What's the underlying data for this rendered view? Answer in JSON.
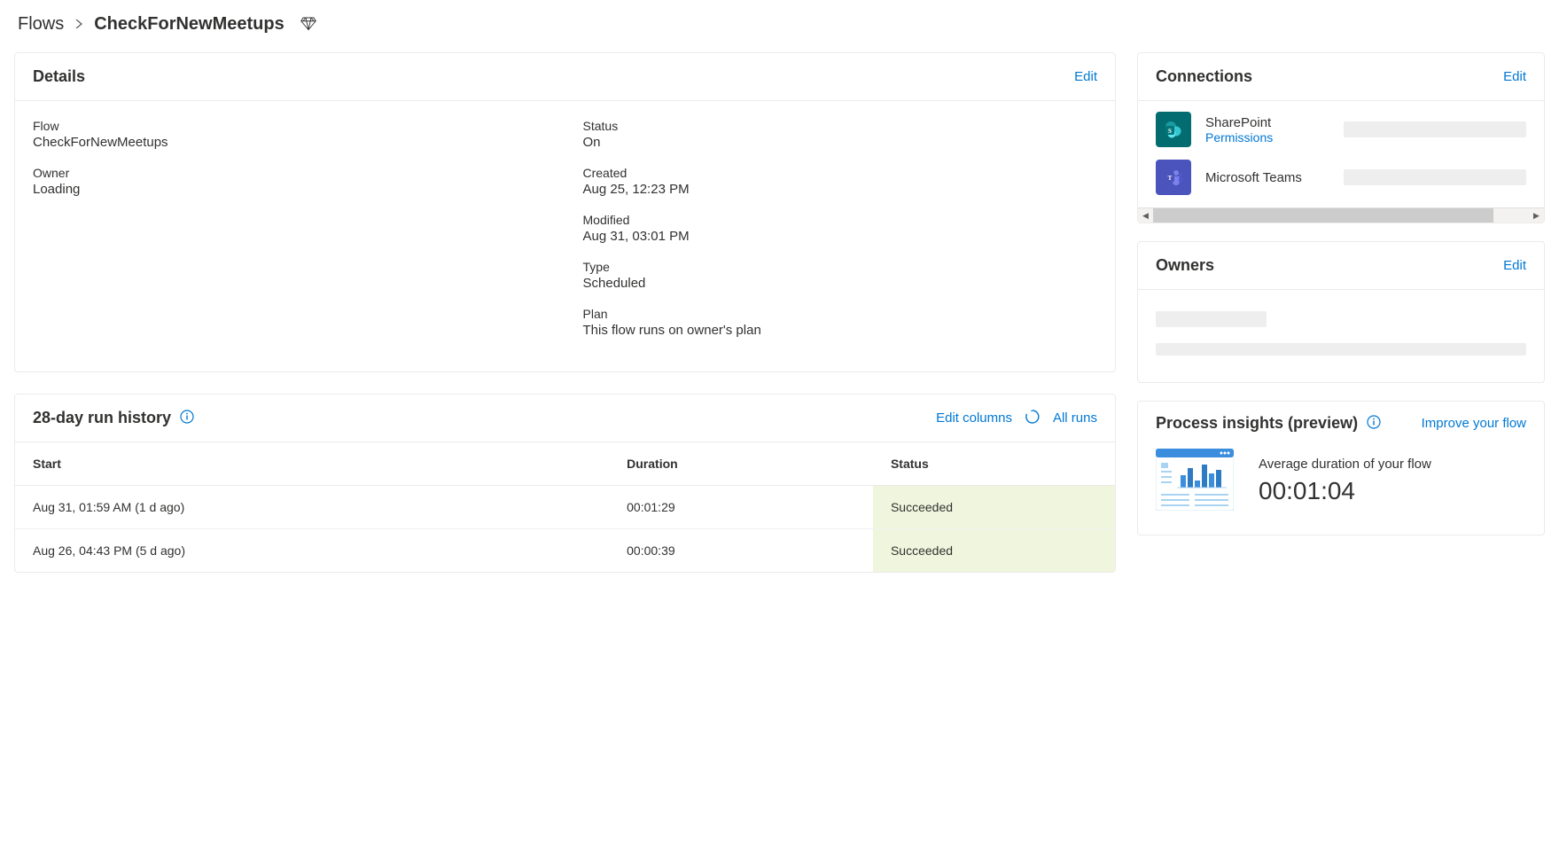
{
  "breadcrumb": {
    "root": "Flows",
    "current": "CheckForNewMeetups"
  },
  "details": {
    "title": "Details",
    "editLabel": "Edit",
    "fields": {
      "flowLabel": "Flow",
      "flowValue": "CheckForNewMeetups",
      "ownerLabel": "Owner",
      "ownerValue": "Loading",
      "statusLabel": "Status",
      "statusValue": "On",
      "createdLabel": "Created",
      "createdValue": "Aug 25, 12:23 PM",
      "modifiedLabel": "Modified",
      "modifiedValue": "Aug 31, 03:01 PM",
      "typeLabel": "Type",
      "typeValue": "Scheduled",
      "planLabel": "Plan",
      "planValue": "This flow runs on owner's plan"
    }
  },
  "history": {
    "title": "28-day run history",
    "editColumnsLabel": "Edit columns",
    "allRunsLabel": "All runs",
    "columns": {
      "start": "Start",
      "duration": "Duration",
      "status": "Status"
    },
    "rows": [
      {
        "start": "Aug 31, 01:59 AM (1 d ago)",
        "duration": "00:01:29",
        "status": "Succeeded"
      },
      {
        "start": "Aug 26, 04:43 PM (5 d ago)",
        "duration": "00:00:39",
        "status": "Succeeded"
      }
    ]
  },
  "connections": {
    "title": "Connections",
    "editLabel": "Edit",
    "items": [
      {
        "name": "SharePoint",
        "permissionsLabel": "Permissions",
        "icon": "sharepoint"
      },
      {
        "name": "Microsoft Teams",
        "permissionsLabel": "",
        "icon": "teams"
      }
    ]
  },
  "owners": {
    "title": "Owners",
    "editLabel": "Edit"
  },
  "insights": {
    "title": "Process insights (preview)",
    "improveLabel": "Improve your flow",
    "avgLabel": "Average duration of your flow",
    "avgValue": "00:01:04"
  }
}
